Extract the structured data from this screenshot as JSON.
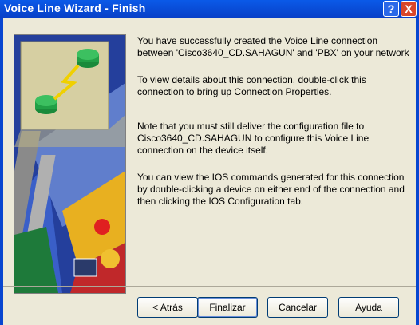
{
  "window": {
    "title": "Voice Line Wizard - Finish",
    "help_glyph": "?",
    "close_glyph": "X"
  },
  "body": {
    "p1": "You have successfully created the Voice Line connection between 'Cisco3640_CD.SAHAGUN' and 'PBX' on your network",
    "p2": "To view details about this connection, double-click this connection to bring up Connection Properties.",
    "p3": "Note that you must still deliver the configuration file to Cisco3640_CD.SAHAGUN to configure this Voice Line connection on the device itself.",
    "p4": "You can view the IOS commands generated for this connection by double-clicking a device on either end of the connection  and then clicking the IOS Configuration tab."
  },
  "buttons": {
    "back": "< Atrás",
    "finish": "Finalizar",
    "cancel": "Cancelar",
    "help": "Ayuda"
  },
  "icons": {
    "illustration": "network-wizard-illustration",
    "help": "help-icon",
    "close": "close-icon"
  },
  "colors": {
    "titlebar": "#0a5ae8",
    "close": "#d9462a",
    "dialog_bg": "#ece9d8"
  }
}
